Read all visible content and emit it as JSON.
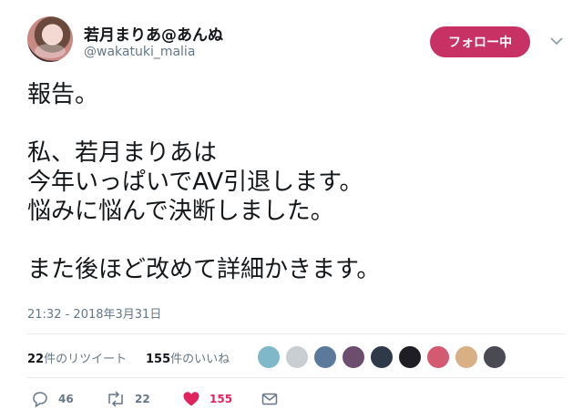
{
  "header": {
    "display_name": "若月まりあ@あんぬ",
    "handle": "@wakatuki_malia",
    "follow_label": "フォロー中"
  },
  "tweet": {
    "lines": [
      "報告。",
      "",
      "私、若月まりあは",
      "今年いっぱいでAV引退します。",
      "悩みに悩んで決断しました。",
      "",
      "また後ほど改めて詳細かきます。"
    ],
    "timestamp": "21:32 - 2018年3月31日"
  },
  "stats": {
    "retweet_count": "22",
    "retweet_label": "件のリツイート",
    "like_count": "155",
    "like_label": "件のいいね"
  },
  "liker_colors": [
    "#7fb8c9",
    "#c9ced3",
    "#5a7a9c",
    "#6c4d6e",
    "#2e3a4a",
    "#1e1e24",
    "#d45a72",
    "#d9b086",
    "#4a4a52"
  ],
  "actions": {
    "reply_count": "46",
    "retweet_count": "22",
    "like_count": "155"
  },
  "colors": {
    "follow_button": "#c83163",
    "like_heart": "#e0245e",
    "secondary_text": "#657786"
  }
}
